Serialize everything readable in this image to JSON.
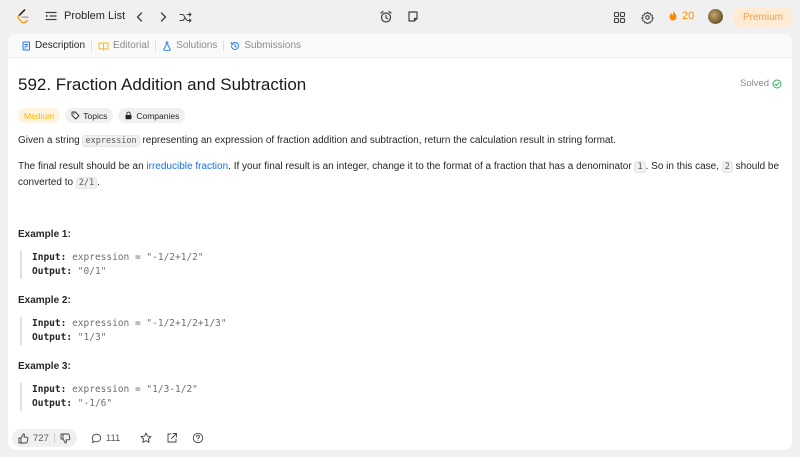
{
  "topbar": {
    "problem_list_label": "Problem List",
    "streak_count": "20",
    "premium_label": "Premium"
  },
  "tabs": [
    {
      "label": "Description",
      "icon": "document-icon",
      "active": true
    },
    {
      "label": "Editorial",
      "icon": "book-icon",
      "active": false
    },
    {
      "label": "Solutions",
      "icon": "flask-icon",
      "active": false
    },
    {
      "label": "Submissions",
      "icon": "history-icon",
      "active": false
    }
  ],
  "problem": {
    "title": "592. Fraction Addition and Subtraction",
    "status": "Solved",
    "difficulty": "Medium",
    "topics_label": "Topics",
    "companies_label": "Companies",
    "desc1_before": "Given a string ",
    "desc1_code": "expression",
    "desc1_after": " representing an expression of fraction addition and subtraction, return the calculation result in string format.",
    "desc2_a": "The final result should be an ",
    "desc2_link": "irreducible fraction",
    "desc2_b": ". If your final result is an integer, change it to the format of a fraction that has a denominator ",
    "desc2_code1": "1",
    "desc2_c": ". So in this case, ",
    "desc2_code2": "2",
    "desc2_d": " should be converted to ",
    "desc2_code3": "2/1",
    "desc2_e": "."
  },
  "examples": [
    {
      "heading": "Example 1:",
      "input_label": "Input:",
      "input_value": "expression = \"-1/2+1/2\"",
      "output_label": "Output:",
      "output_value": "\"0/1\""
    },
    {
      "heading": "Example 2:",
      "input_label": "Input:",
      "input_value": "expression = \"-1/2+1/2+1/3\"",
      "output_label": "Output:",
      "output_value": "\"1/3\""
    },
    {
      "heading": "Example 3:",
      "input_label": "Input:",
      "input_value": "expression = \"1/3-1/2\"",
      "output_label": "Output:",
      "output_value": "\"-1/6\""
    }
  ],
  "footer": {
    "likes": "727",
    "comments": "111"
  },
  "colors": {
    "accent_orange": "#ffa116",
    "link_blue": "#1a73e8",
    "medium": "#ffb800",
    "solved_green": "#2db55d"
  }
}
